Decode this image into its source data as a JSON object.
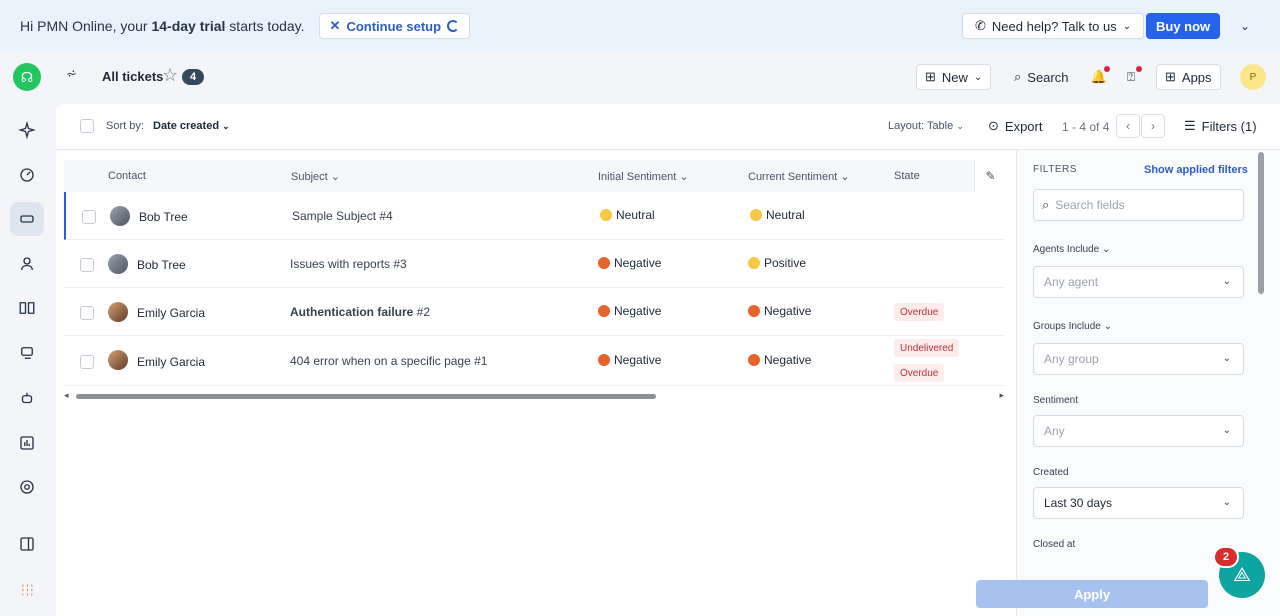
{
  "banner": {
    "greeting_prefix": "Hi PMN Online, your ",
    "trial_bold": "14-day trial",
    "greeting_suffix": " starts today.",
    "continue_label": "Continue setup",
    "help_label": "Need help? Talk to us",
    "buy_label": "Buy now"
  },
  "header": {
    "title": "All tickets",
    "count": "4",
    "new_label": "New",
    "search_label": "Search",
    "apps_label": "Apps",
    "avatar_initial": "P"
  },
  "toolbar": {
    "sort_label": "Sort by:",
    "sort_value": "Date created",
    "layout_label": "Layout: Table",
    "export_label": "Export",
    "pages": "1 - 4 of 4",
    "filters_label": "Filters (1)"
  },
  "table": {
    "columns": [
      "Contact",
      "Subject",
      "Initial Sentiment",
      "Current Sentiment",
      "State"
    ],
    "rows": [
      {
        "contact": "Bob Tree",
        "subject": "Sample Subject #4",
        "subject_bold": "",
        "initial": "Neutral",
        "current": "Neutral",
        "states": []
      },
      {
        "contact": "Bob Tree",
        "subject": "Issues with reports #3",
        "subject_bold": "",
        "initial": "Negative",
        "current": "Positive",
        "states": []
      },
      {
        "contact": "Emily Garcia",
        "subject": " #2",
        "subject_bold": "Authentication failure",
        "initial": "Negative",
        "current": "Negative",
        "states": [
          "Overdue"
        ]
      },
      {
        "contact": "Emily Garcia",
        "subject": "404 error when on a specific page #1",
        "subject_bold": "",
        "initial": "Negative",
        "current": "Negative",
        "states": [
          "Undelivered",
          "Overdue"
        ]
      }
    ]
  },
  "filters": {
    "title": "FILTERS",
    "show_applied": "Show applied filters",
    "search_placeholder": "Search fields",
    "agents_label": "Agents Include",
    "agents_value": "Any agent",
    "groups_label": "Groups Include",
    "groups_value": "Any group",
    "sentiment_label": "Sentiment",
    "sentiment_value": "Any",
    "created_label": "Created",
    "created_value": "Last 30 days",
    "closed_label": "Closed at",
    "apply_label": "Apply"
  },
  "fab": {
    "badge": "2"
  },
  "colors": {
    "accent": "#2563eb",
    "banner_bg": "#eaf2fb",
    "overdue_bg": "#fdecec",
    "overdue_text": "#c0303a",
    "fab": "#0ea5a0"
  }
}
